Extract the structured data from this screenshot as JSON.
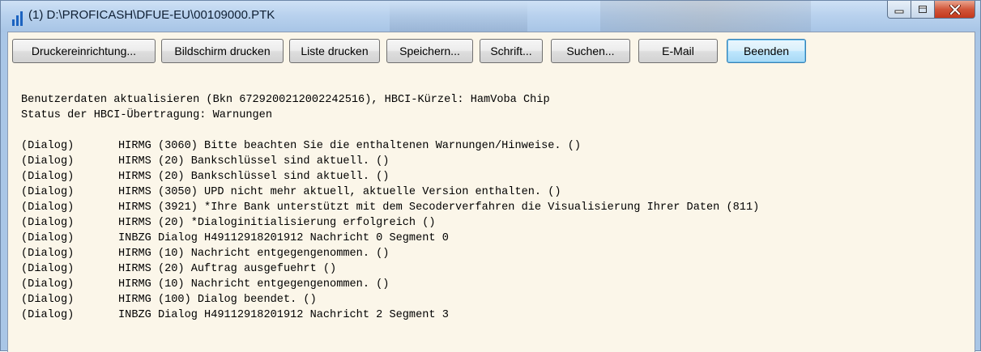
{
  "window": {
    "title": "(1) D:\\PROFICASH\\DFUE-EU\\00109000.PTK"
  },
  "toolbar": {
    "buttons": [
      {
        "label": "Druckereinrichtung..."
      },
      {
        "label": "Bildschirm drucken"
      },
      {
        "label": "Liste drucken"
      },
      {
        "label": "Speichern..."
      },
      {
        "label": "Schrift..."
      },
      {
        "label": "Suchen..."
      },
      {
        "label": "E-Mail"
      },
      {
        "label": "Beenden",
        "default": true
      }
    ]
  },
  "log": {
    "header": [
      "Benutzerdaten aktualisieren (Bkn 6729200212002242516), HBCI-Kürzel: HamVoba Chip",
      "Status der HBCI-Übertragung: Warnungen"
    ],
    "entries": [
      {
        "source": "(Dialog)",
        "message": "HIRMG (3060) Bitte beachten Sie die enthaltenen Warnungen/Hinweise. ()"
      },
      {
        "source": "(Dialog)",
        "message": "HIRMS (20) Bankschlüssel sind aktuell. ()"
      },
      {
        "source": "(Dialog)",
        "message": "HIRMS (20) Bankschlüssel sind aktuell. ()"
      },
      {
        "source": "(Dialog)",
        "message": "HIRMS (3050) UPD nicht mehr aktuell, aktuelle Version enthalten. ()"
      },
      {
        "source": "(Dialog)",
        "message": "HIRMS (3921) *Ihre Bank unterstützt mit dem Secoderverfahren die Visualisierung Ihrer Daten (811)"
      },
      {
        "source": "(Dialog)",
        "message": "HIRMS (20) *Dialoginitialisierung erfolgreich ()"
      },
      {
        "source": "(Dialog)",
        "message": "INBZG Dialog H49112918201912 Nachricht 0 Segment 0"
      },
      {
        "source": "(Dialog)",
        "message": "HIRMG (10) Nachricht entgegengenommen. ()"
      },
      {
        "source": "(Dialog)",
        "message": "HIRMS (20) Auftrag ausgefuehrt ()"
      },
      {
        "source": "(Dialog)",
        "message": "HIRMG (10) Nachricht entgegengenommen. ()"
      },
      {
        "source": "(Dialog)",
        "message": "HIRMG (100) Dialog beendet. ()"
      },
      {
        "source": "(Dialog)",
        "message": "INBZG Dialog H49112918201912 Nachricht 2 Segment 3"
      }
    ]
  }
}
